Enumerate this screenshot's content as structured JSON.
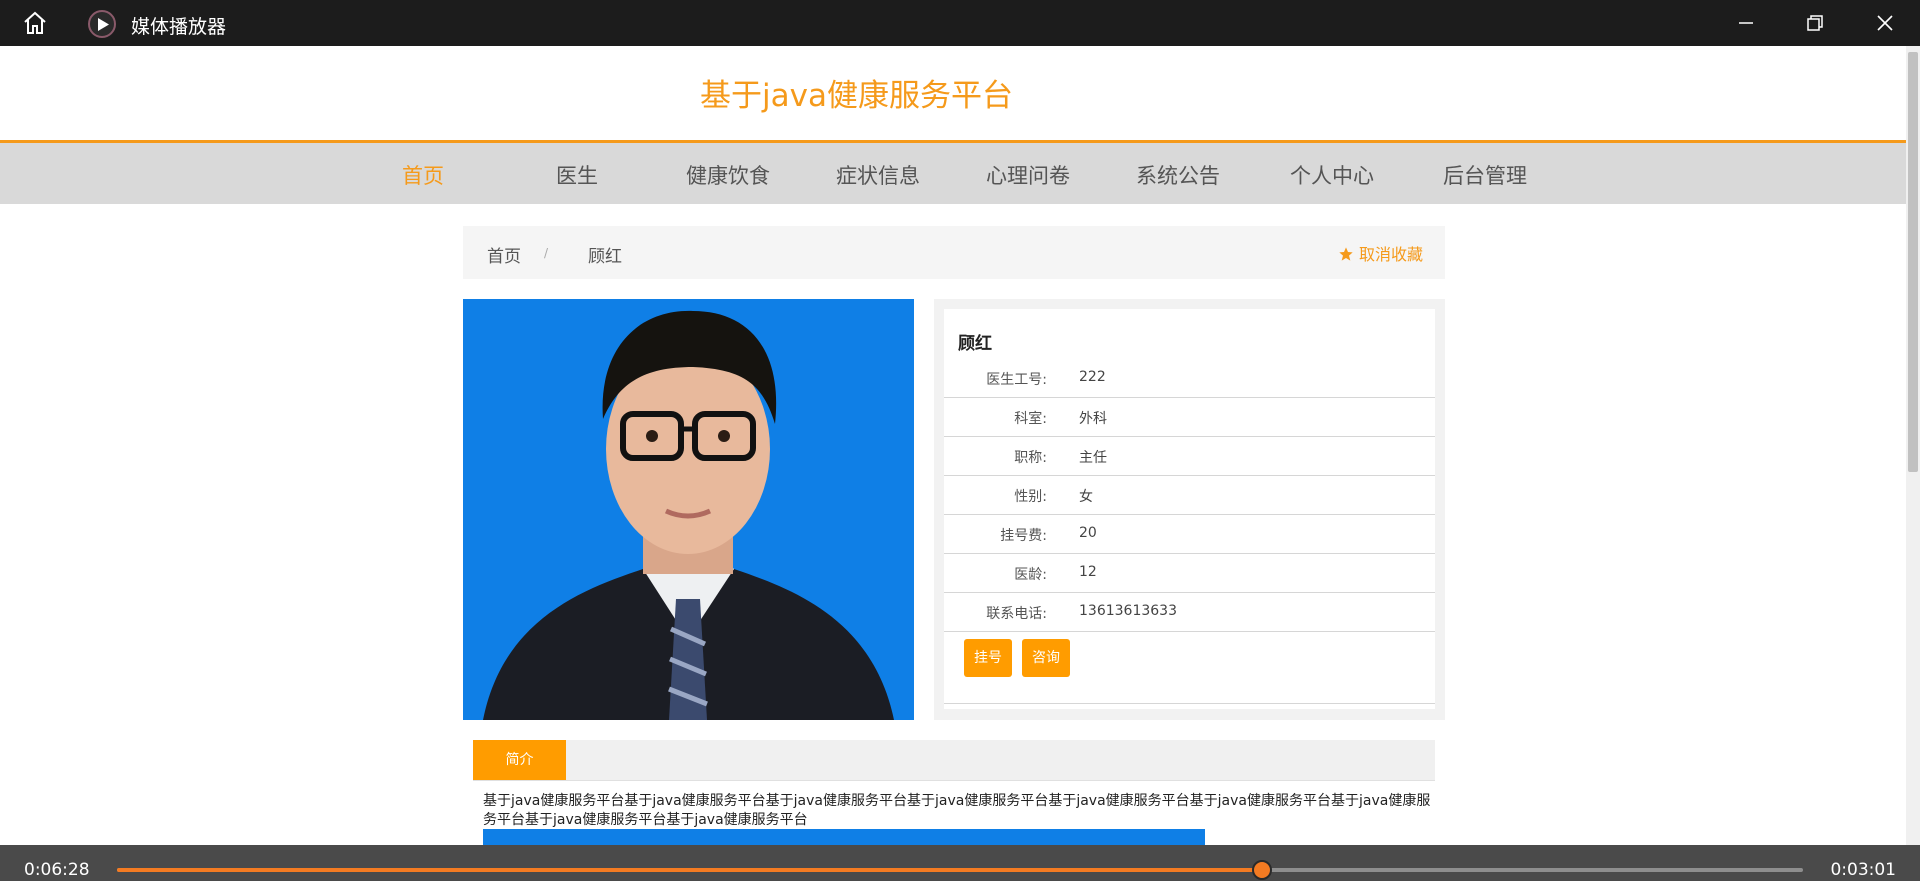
{
  "window": {
    "title": "媒体播放器",
    "accent": "#f47b22"
  },
  "site": {
    "title": "基于java健康服务平台",
    "brand_color": "#f59a1b",
    "nav": [
      {
        "label": "首页",
        "active": true
      },
      {
        "label": "医生",
        "active": false
      },
      {
        "label": "健康饮食",
        "active": false
      },
      {
        "label": "症状信息",
        "active": false
      },
      {
        "label": "心理问卷",
        "active": false
      },
      {
        "label": "系统公告",
        "active": false
      },
      {
        "label": "个人中心",
        "active": false
      },
      {
        "label": "后台管理",
        "active": false
      }
    ]
  },
  "breadcrumb": {
    "home": "首页",
    "separator": "/",
    "current": "顾红",
    "favorite_label": "取消收藏",
    "favorite_icon": "star-icon"
  },
  "doctor": {
    "name": "顾红",
    "fields": [
      {
        "label": "医生工号:",
        "value": "222"
      },
      {
        "label": "科室:",
        "value": "外科"
      },
      {
        "label": "职称:",
        "value": "主任"
      },
      {
        "label": "性别:",
        "value": "女"
      },
      {
        "label": "挂号费:",
        "value": "20"
      },
      {
        "label": "医龄:",
        "value": "12"
      },
      {
        "label": "联系电话:",
        "value": "13613613633"
      }
    ],
    "buttons": {
      "register": "挂号",
      "consult": "咨询"
    }
  },
  "intro": {
    "tab_label": "简介",
    "text": "基于java健康服务平台基于java健康服务平台基于java健康服务平台基于java健康服务平台基于java健康服务平台基于java健康服务平台基于java健康服务平台基于java健康服务平台基于java健康服务平台"
  },
  "player": {
    "current_time": "0:06:28",
    "total_time": "0:03:01",
    "progress": 0.679
  }
}
